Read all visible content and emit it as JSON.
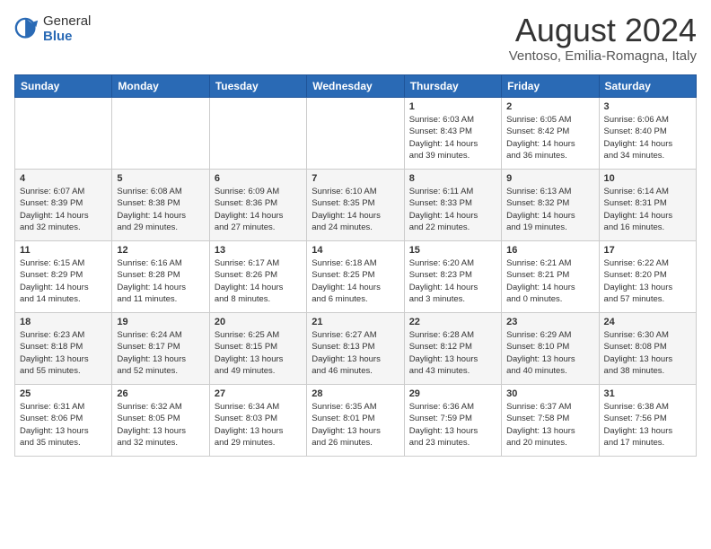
{
  "header": {
    "logo_general": "General",
    "logo_blue": "Blue",
    "month_year": "August 2024",
    "location": "Ventoso, Emilia-Romagna, Italy"
  },
  "weekdays": [
    "Sunday",
    "Monday",
    "Tuesday",
    "Wednesday",
    "Thursday",
    "Friday",
    "Saturday"
  ],
  "weeks": [
    [
      {
        "day": "",
        "info": ""
      },
      {
        "day": "",
        "info": ""
      },
      {
        "day": "",
        "info": ""
      },
      {
        "day": "",
        "info": ""
      },
      {
        "day": "1",
        "info": "Sunrise: 6:03 AM\nSunset: 8:43 PM\nDaylight: 14 hours\nand 39 minutes."
      },
      {
        "day": "2",
        "info": "Sunrise: 6:05 AM\nSunset: 8:42 PM\nDaylight: 14 hours\nand 36 minutes."
      },
      {
        "day": "3",
        "info": "Sunrise: 6:06 AM\nSunset: 8:40 PM\nDaylight: 14 hours\nand 34 minutes."
      }
    ],
    [
      {
        "day": "4",
        "info": "Sunrise: 6:07 AM\nSunset: 8:39 PM\nDaylight: 14 hours\nand 32 minutes."
      },
      {
        "day": "5",
        "info": "Sunrise: 6:08 AM\nSunset: 8:38 PM\nDaylight: 14 hours\nand 29 minutes."
      },
      {
        "day": "6",
        "info": "Sunrise: 6:09 AM\nSunset: 8:36 PM\nDaylight: 14 hours\nand 27 minutes."
      },
      {
        "day": "7",
        "info": "Sunrise: 6:10 AM\nSunset: 8:35 PM\nDaylight: 14 hours\nand 24 minutes."
      },
      {
        "day": "8",
        "info": "Sunrise: 6:11 AM\nSunset: 8:33 PM\nDaylight: 14 hours\nand 22 minutes."
      },
      {
        "day": "9",
        "info": "Sunrise: 6:13 AM\nSunset: 8:32 PM\nDaylight: 14 hours\nand 19 minutes."
      },
      {
        "day": "10",
        "info": "Sunrise: 6:14 AM\nSunset: 8:31 PM\nDaylight: 14 hours\nand 16 minutes."
      }
    ],
    [
      {
        "day": "11",
        "info": "Sunrise: 6:15 AM\nSunset: 8:29 PM\nDaylight: 14 hours\nand 14 minutes."
      },
      {
        "day": "12",
        "info": "Sunrise: 6:16 AM\nSunset: 8:28 PM\nDaylight: 14 hours\nand 11 minutes."
      },
      {
        "day": "13",
        "info": "Sunrise: 6:17 AM\nSunset: 8:26 PM\nDaylight: 14 hours\nand 8 minutes."
      },
      {
        "day": "14",
        "info": "Sunrise: 6:18 AM\nSunset: 8:25 PM\nDaylight: 14 hours\nand 6 minutes."
      },
      {
        "day": "15",
        "info": "Sunrise: 6:20 AM\nSunset: 8:23 PM\nDaylight: 14 hours\nand 3 minutes."
      },
      {
        "day": "16",
        "info": "Sunrise: 6:21 AM\nSunset: 8:21 PM\nDaylight: 14 hours\nand 0 minutes."
      },
      {
        "day": "17",
        "info": "Sunrise: 6:22 AM\nSunset: 8:20 PM\nDaylight: 13 hours\nand 57 minutes."
      }
    ],
    [
      {
        "day": "18",
        "info": "Sunrise: 6:23 AM\nSunset: 8:18 PM\nDaylight: 13 hours\nand 55 minutes."
      },
      {
        "day": "19",
        "info": "Sunrise: 6:24 AM\nSunset: 8:17 PM\nDaylight: 13 hours\nand 52 minutes."
      },
      {
        "day": "20",
        "info": "Sunrise: 6:25 AM\nSunset: 8:15 PM\nDaylight: 13 hours\nand 49 minutes."
      },
      {
        "day": "21",
        "info": "Sunrise: 6:27 AM\nSunset: 8:13 PM\nDaylight: 13 hours\nand 46 minutes."
      },
      {
        "day": "22",
        "info": "Sunrise: 6:28 AM\nSunset: 8:12 PM\nDaylight: 13 hours\nand 43 minutes."
      },
      {
        "day": "23",
        "info": "Sunrise: 6:29 AM\nSunset: 8:10 PM\nDaylight: 13 hours\nand 40 minutes."
      },
      {
        "day": "24",
        "info": "Sunrise: 6:30 AM\nSunset: 8:08 PM\nDaylight: 13 hours\nand 38 minutes."
      }
    ],
    [
      {
        "day": "25",
        "info": "Sunrise: 6:31 AM\nSunset: 8:06 PM\nDaylight: 13 hours\nand 35 minutes."
      },
      {
        "day": "26",
        "info": "Sunrise: 6:32 AM\nSunset: 8:05 PM\nDaylight: 13 hours\nand 32 minutes."
      },
      {
        "day": "27",
        "info": "Sunrise: 6:34 AM\nSunset: 8:03 PM\nDaylight: 13 hours\nand 29 minutes."
      },
      {
        "day": "28",
        "info": "Sunrise: 6:35 AM\nSunset: 8:01 PM\nDaylight: 13 hours\nand 26 minutes."
      },
      {
        "day": "29",
        "info": "Sunrise: 6:36 AM\nSunset: 7:59 PM\nDaylight: 13 hours\nand 23 minutes."
      },
      {
        "day": "30",
        "info": "Sunrise: 6:37 AM\nSunset: 7:58 PM\nDaylight: 13 hours\nand 20 minutes."
      },
      {
        "day": "31",
        "info": "Sunrise: 6:38 AM\nSunset: 7:56 PM\nDaylight: 13 hours\nand 17 minutes."
      }
    ]
  ]
}
